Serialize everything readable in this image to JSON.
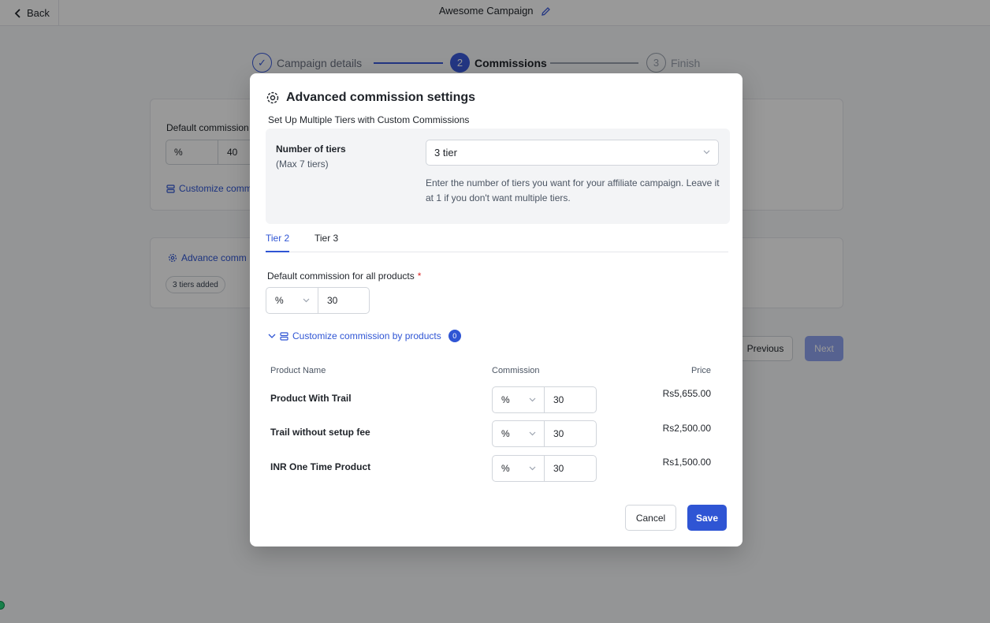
{
  "topbar": {
    "back_label": "Back",
    "campaign_title": "Awesome Campaign"
  },
  "stepper": [
    {
      "number": "✓",
      "label": "Campaign details",
      "state": "done"
    },
    {
      "number": "2",
      "label": "Commissions",
      "state": "active"
    },
    {
      "number": "3",
      "label": "Finish",
      "state": "todo"
    }
  ],
  "background": {
    "default_commission_label": "Default commission",
    "unit": "%",
    "value": "40",
    "customize_link": "Customize comm",
    "advance_link": "Advance comm",
    "tiers_badge": "3 tiers added",
    "previous_label": "Previous",
    "next_label": "Next"
  },
  "modal": {
    "title": "Advanced commission settings",
    "subtitle": "Set Up Multiple Tiers with Custom Commissions",
    "tiers": {
      "label": "Number of tiers",
      "max": "(Max 7 tiers)",
      "selected": "3 tier",
      "help": "Enter the number of tiers you want for your affiliate campaign. Leave it at 1 if you don't want multiple tiers."
    },
    "tabs": [
      {
        "label": "Tier 2",
        "active": true
      },
      {
        "label": "Tier 3",
        "active": false
      }
    ],
    "default_commission": {
      "label": "Default commission for all products",
      "required": "*",
      "unit": "%",
      "value": "30"
    },
    "customize": {
      "label": "Customize commission by products",
      "count": "0"
    },
    "table": {
      "headers": {
        "name": "Product Name",
        "commission": "Commission",
        "price": "Price"
      },
      "rows": [
        {
          "name": "Product With Trail",
          "unit": "%",
          "value": "30",
          "price": "Rs5,655.00"
        },
        {
          "name": "Trail without setup fee",
          "unit": "%",
          "value": "30",
          "price": "Rs2,500.00"
        },
        {
          "name": "INR One Time Product",
          "unit": "%",
          "value": "30",
          "price": "Rs1,500.00"
        }
      ]
    },
    "cancel_label": "Cancel",
    "save_label": "Save"
  },
  "colors": {
    "accent": "#2f55d4",
    "overlay": "rgba(0,0,0,0.4)",
    "required": "#dc2626"
  }
}
